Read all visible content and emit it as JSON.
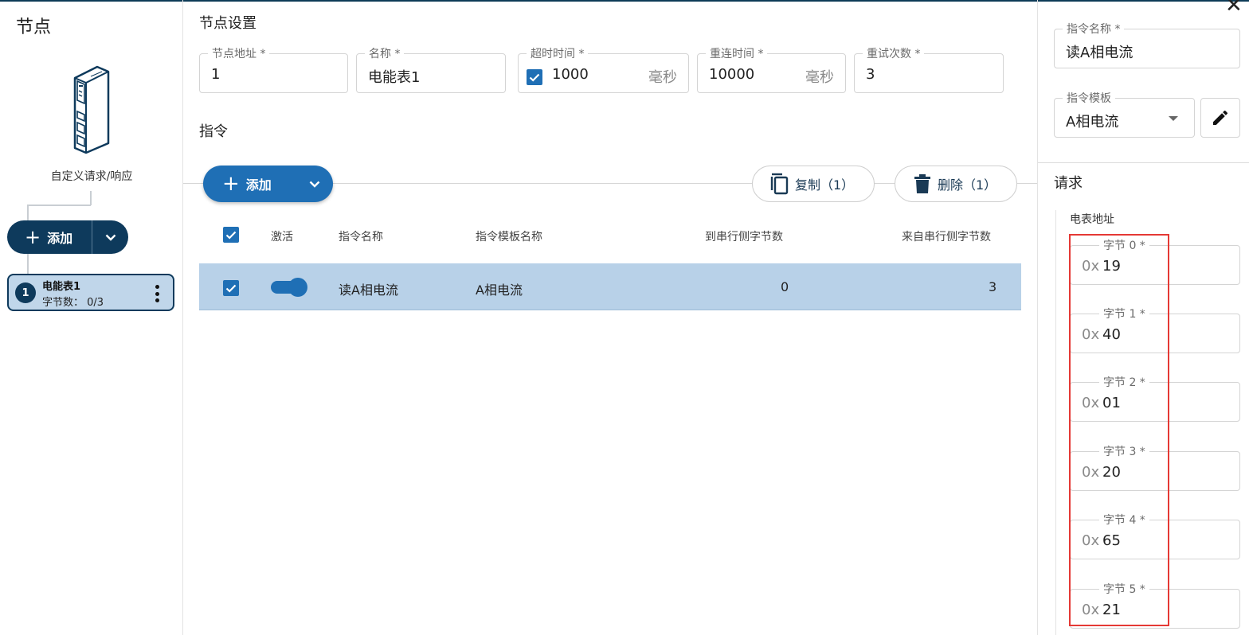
{
  "left": {
    "title": "节点",
    "device_label": "自定义请求/响应",
    "add_label": "添加",
    "nodes": [
      {
        "index": "1",
        "name": "电能表1",
        "bytes_text": "字节数： 0/3"
      }
    ]
  },
  "node_settings": {
    "title": "节点设置",
    "fields": {
      "address": {
        "label": "节点地址 *",
        "value": "1"
      },
      "name": {
        "label": "名称 *",
        "value": "电能表1"
      },
      "timeout": {
        "label": "超时时间 *",
        "value": "1000",
        "unit": "毫秒",
        "enabled": true
      },
      "reconnect": {
        "label": "重连时间 *",
        "value": "10000",
        "unit": "毫秒"
      },
      "retries": {
        "label": "重试次数 *",
        "value": "3"
      }
    }
  },
  "commands": {
    "title": "指令",
    "add_label": "添加",
    "copy_label": "复制（1）",
    "delete_label": "删除（1）",
    "columns": [
      "激活",
      "指令名称",
      "指令模板名称",
      "到串行侧字节数",
      "来自串行侧字节数"
    ],
    "rows": [
      {
        "checked": true,
        "active": true,
        "name": "读A相电流",
        "template": "A相电流",
        "to_serial": "0",
        "from_serial": "3"
      }
    ]
  },
  "detail": {
    "name_field": {
      "label": "指令名称 *",
      "value": "读A相电流"
    },
    "template_field": {
      "label": "指令模板",
      "value": "A相电流"
    },
    "request_title": "请求",
    "group_label": "电表地址",
    "byte_prefix": "0x",
    "bytes": [
      {
        "label": "字节 0 *",
        "value": "19"
      },
      {
        "label": "字节 1 *",
        "value": "40"
      },
      {
        "label": "字节 2 *",
        "value": "01"
      },
      {
        "label": "字节 3 *",
        "value": "20"
      },
      {
        "label": "字节 4 *",
        "value": "65"
      },
      {
        "label": "字节 5 *",
        "value": "21"
      }
    ]
  },
  "colors": {
    "primary": "#1f6fb5",
    "dark": "#0e3a5c",
    "selected_row": "#b8d1e8",
    "highlight_box": "#e53935"
  }
}
